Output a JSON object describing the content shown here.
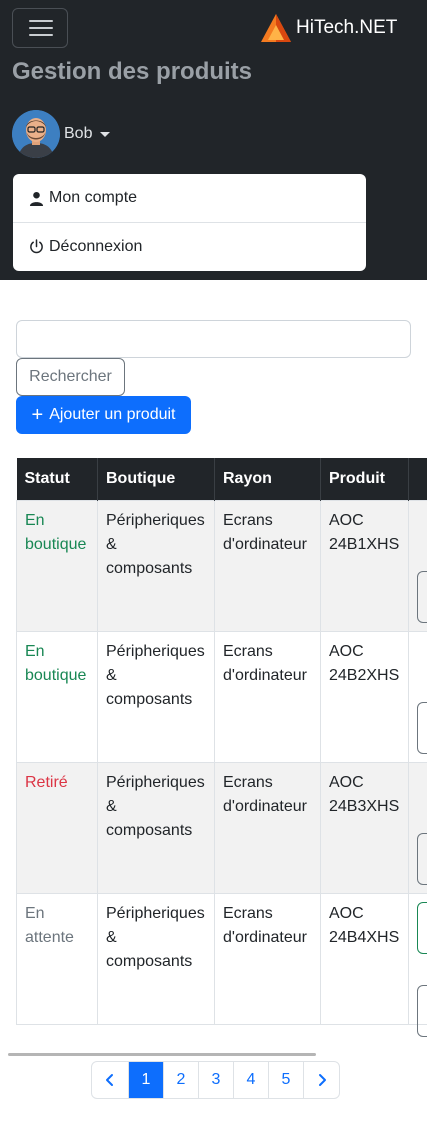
{
  "brand": {
    "name": "HiTech.NET"
  },
  "header": {
    "title": "Gestion des produits"
  },
  "user": {
    "name": "Bob",
    "menu": [
      {
        "label": "Mon compte",
        "icon": "person-icon"
      },
      {
        "label": "Déconnexion",
        "icon": "power-icon"
      }
    ]
  },
  "search": {
    "placeholder": "",
    "value": "",
    "button_label": "Rechercher"
  },
  "actions": {
    "add_label": "Ajouter un produit"
  },
  "table": {
    "columns": [
      "Statut",
      "Boutique",
      "Rayon",
      "Produit",
      ""
    ],
    "rows": [
      {
        "status": "En boutique",
        "shop": "Péripheriques & composants",
        "rayon": "Ecrans d'ordinateur",
        "product": "AOC 24B1XHS"
      },
      {
        "status": "En boutique",
        "shop": "Péripheriques & composants",
        "rayon": "Ecrans d'ordinateur",
        "product": "AOC 24B2XHS"
      },
      {
        "status": "Retiré",
        "shop": "Péripheriques & composants",
        "rayon": "Ecrans d'ordinateur",
        "product": "AOC 24B3XHS"
      },
      {
        "status": "En attente",
        "shop": "Péripheriques & composants",
        "rayon": "Ecrans d'ordinateur",
        "product": "AOC 24B4XHS"
      }
    ]
  },
  "pagination": {
    "prev_icon": "chevron-left-icon",
    "next_icon": "chevron-right-icon",
    "pages": [
      "1",
      "2",
      "3",
      "4",
      "5"
    ],
    "current": "1"
  },
  "colors": {
    "navbar": "#212529",
    "primary": "#0d6efd",
    "success": "#198754",
    "danger": "#dc3545",
    "muted": "#6c757d"
  }
}
